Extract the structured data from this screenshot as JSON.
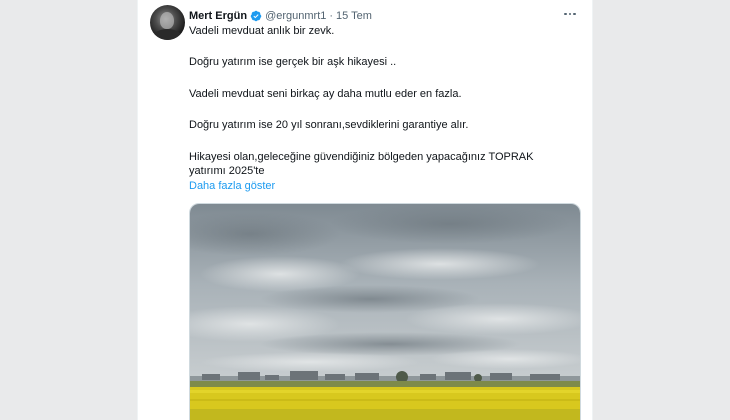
{
  "tweet": {
    "author_name": "Mert Ergün",
    "handle": "@ergunmrt1",
    "separator": "·",
    "date": "15 Tem",
    "lines": [
      "Vadeli mevduat anlık bir zevk.",
      "Doğru yatırım ise gerçek bir aşk hikayesi ..",
      "Vadeli mevduat seni birkaç ay daha mutlu eder en fazla.",
      "Doğru yatırım ise 20 yıl sonranı,sevdiklerini garantiye alır.",
      "Hikayesi olan,geleceğine güvendiğiniz bölgeden yapacağınız TOPRAK",
      "yatırımı 2025'te"
    ],
    "show_more_label": "Daha fazla göster",
    "icons": {
      "verified": "verified-badge-icon",
      "more": "more-options-icon"
    },
    "media": {
      "image": "photo of yellow rapeseed field under cloudy sky with distant buildings"
    },
    "colors": {
      "link": "#1d9bf0",
      "verified": "#1d9bf0",
      "text": "#0f1419",
      "secondary": "#536471"
    }
  }
}
